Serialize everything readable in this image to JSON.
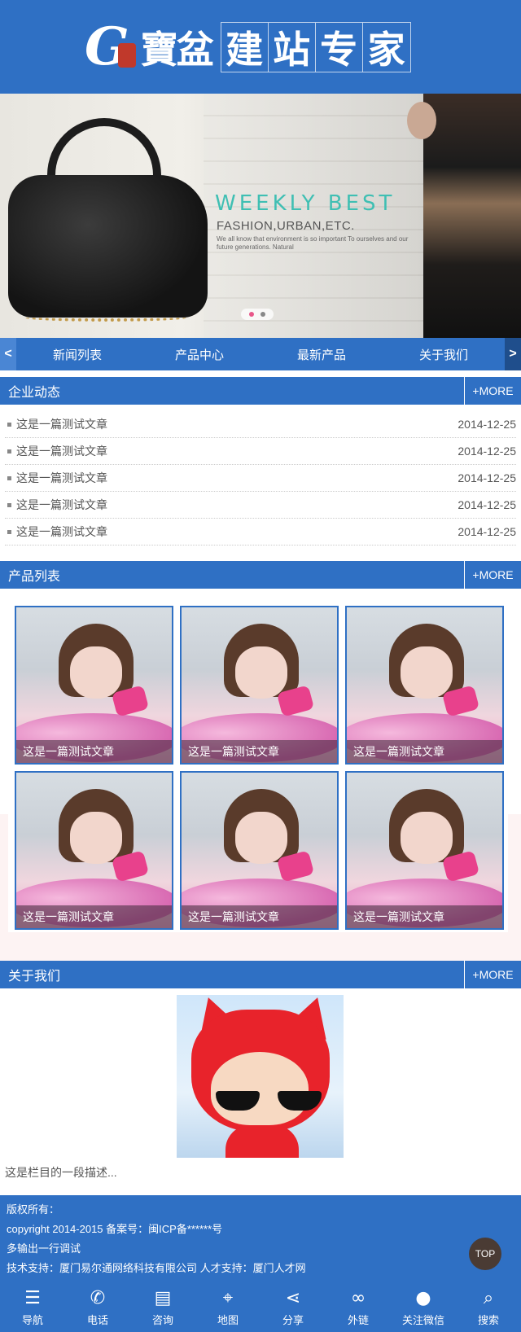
{
  "header": {
    "logo_letter": "G",
    "logo_brand": "寶盆",
    "slogan_chars": [
      "建",
      "站",
      "专",
      "家"
    ]
  },
  "banner": {
    "title": "WEEKLY  BEST",
    "subtitle": "FASHION,URBAN,ETC.",
    "text": "We all know that environment is so important To ourselves and our future generations. Natural"
  },
  "nav": {
    "left_arrow": "<",
    "right_arrow": ">",
    "items": [
      "新闻列表",
      "产品中心",
      "最新产品",
      "关于我们"
    ]
  },
  "news_section": {
    "title": "企业动态",
    "more": "+MORE",
    "items": [
      {
        "title": "这是一篇测试文章",
        "date": "2014-12-25"
      },
      {
        "title": "这是一篇测试文章",
        "date": "2014-12-25"
      },
      {
        "title": "这是一篇测试文章",
        "date": "2014-12-25"
      },
      {
        "title": "这是一篇测试文章",
        "date": "2014-12-25"
      },
      {
        "title": "这是一篇测试文章",
        "date": "2014-12-25"
      }
    ]
  },
  "products_section": {
    "title": "产品列表",
    "more": "+MORE",
    "items": [
      {
        "caption": "这是一篇测试文章"
      },
      {
        "caption": "这是一篇测试文章"
      },
      {
        "caption": "这是一篇测试文章"
      },
      {
        "caption": "这是一篇测试文章"
      },
      {
        "caption": "这是一篇测试文章"
      },
      {
        "caption": "这是一篇测试文章"
      }
    ]
  },
  "about_section": {
    "title": "关于我们",
    "more": "+MORE",
    "description": "这是栏目的一段描述..."
  },
  "footer": {
    "lines": [
      "版权所有：",
      "copyright 2014-2015 备案号：闽ICP备******号",
      "多输出一行调试",
      "技术支持：厦门易尔通网络科技有限公司 人才支持：厦门人才网"
    ],
    "top_label": "TOP"
  },
  "bottom_bar": [
    {
      "label": "导航",
      "icon": "menu-icon"
    },
    {
      "label": "电话",
      "icon": "phone-icon"
    },
    {
      "label": "咨询",
      "icon": "chat-icon"
    },
    {
      "label": "地图",
      "icon": "map-icon"
    },
    {
      "label": "分享",
      "icon": "share-icon"
    },
    {
      "label": "外链",
      "icon": "link-icon"
    },
    {
      "label": "关注微信",
      "icon": "wechat-icon"
    },
    {
      "label": "搜索",
      "icon": "search-icon"
    }
  ],
  "colors": {
    "primary": "#2f70c4",
    "accent_teal": "#3fbfb3",
    "dot_active": "#e8578a"
  }
}
